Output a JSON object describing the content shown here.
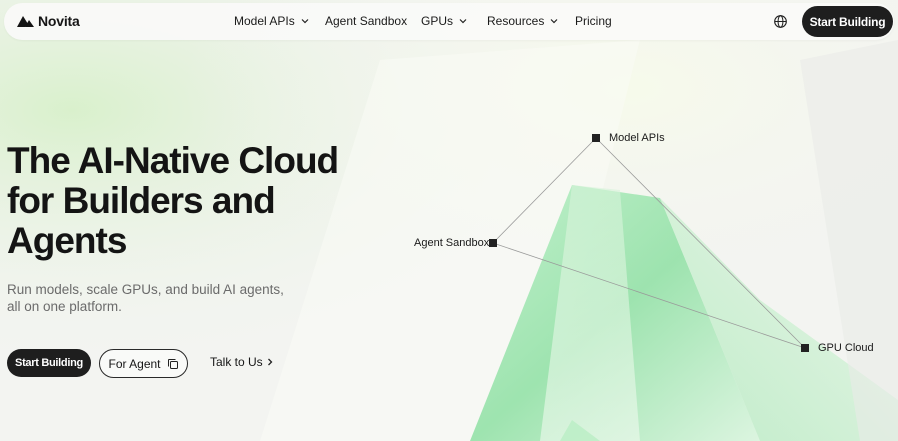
{
  "nav": {
    "brand": "Novita",
    "items": [
      {
        "label": "Model APIs",
        "has_dropdown": true
      },
      {
        "label": "Agent Sandbox",
        "has_dropdown": false
      },
      {
        "label": "GPUs",
        "has_dropdown": true
      },
      {
        "label": "Resources",
        "has_dropdown": true
      },
      {
        "label": "Pricing",
        "has_dropdown": false
      }
    ],
    "globe_icon": "globe-icon",
    "cta": "Start Building"
  },
  "hero": {
    "title_lines": [
      "The AI-Native Cloud",
      "for Builders and",
      "Agents"
    ],
    "subtitle": "Run models, scale GPUs, and build AI agents, all on one platform.",
    "primary_button": "Start Building",
    "secondary_button": "For Agent",
    "secondary_icon": "copy-icon",
    "link": "Talk to Us",
    "link_icon": "chevron-right-icon"
  },
  "diagram": {
    "nodes": [
      "Model APIs",
      "Agent Sandbox",
      "GPU Cloud"
    ]
  },
  "colors": {
    "primary_dark": "#1e1e1e",
    "accent_green": "#8fe3a8",
    "background": "#f3f4f1"
  }
}
